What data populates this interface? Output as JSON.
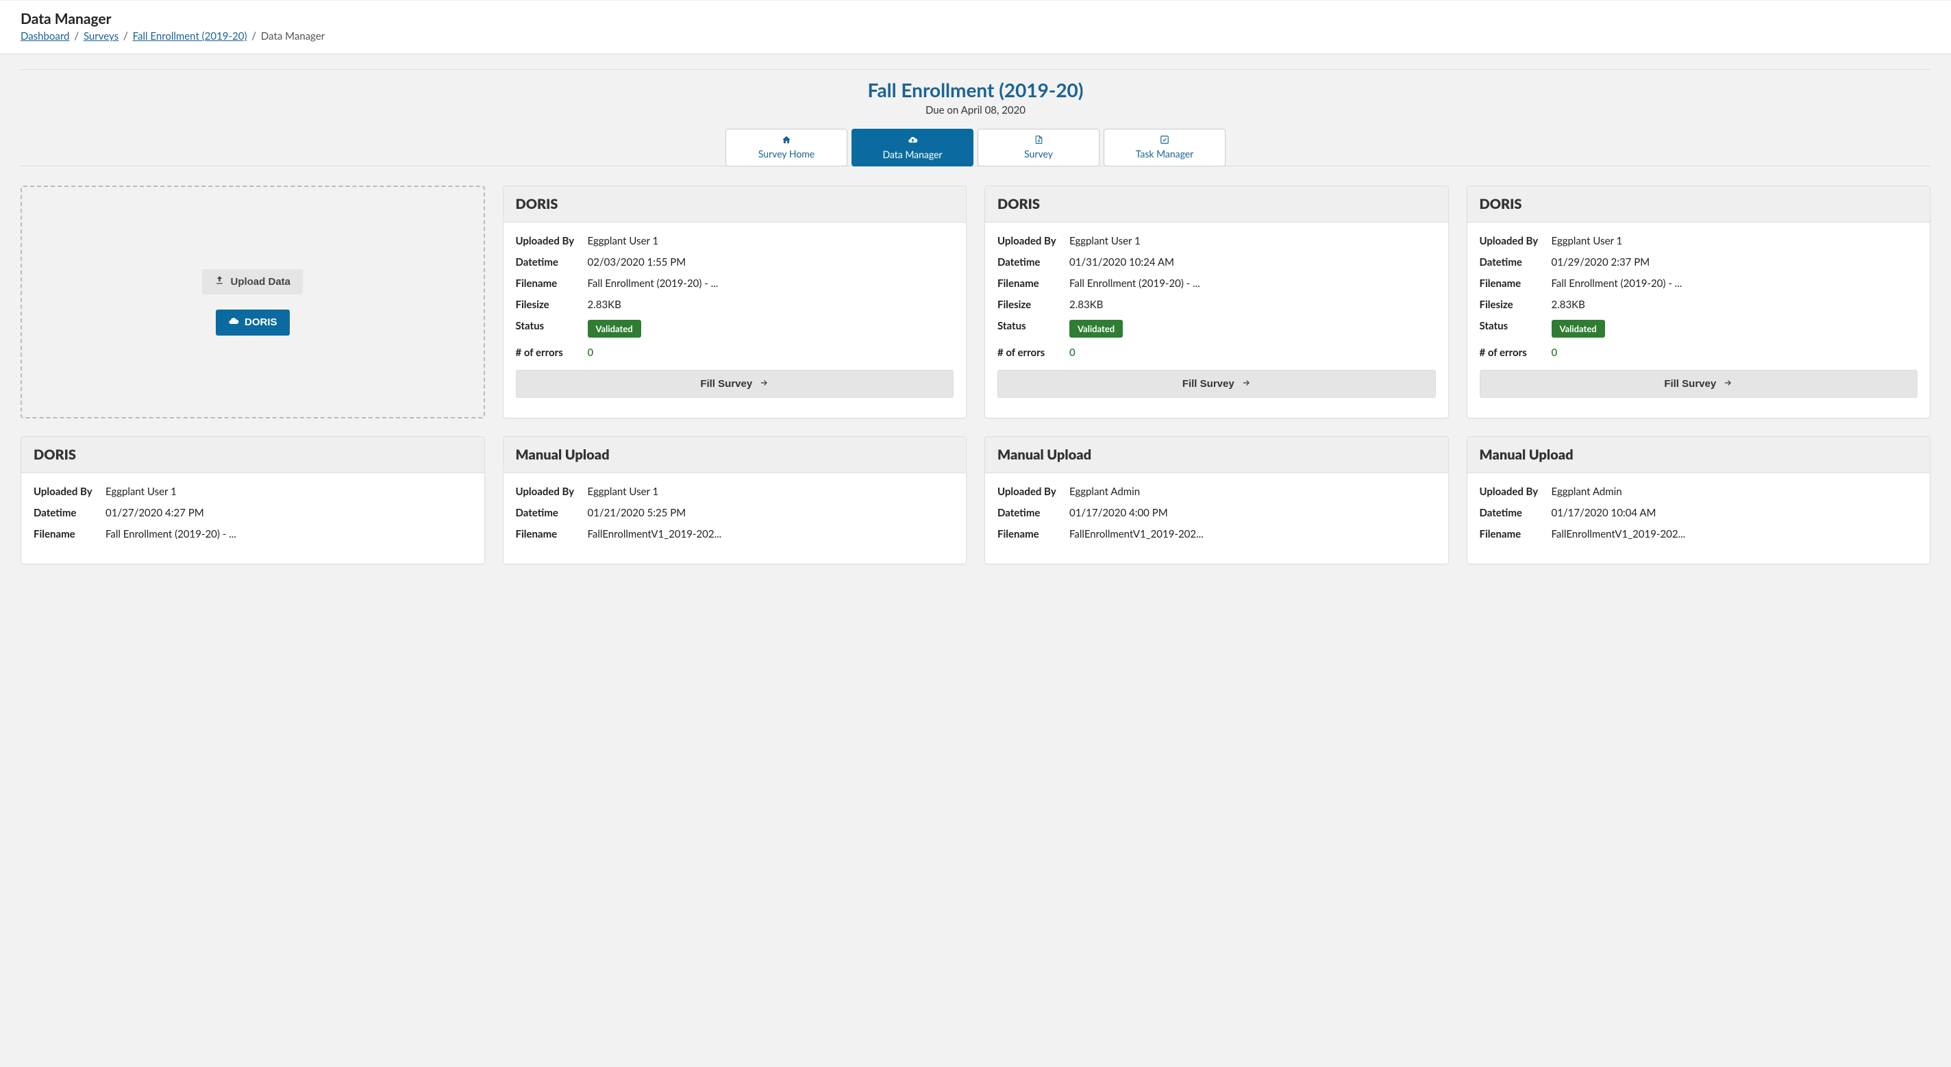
{
  "header": {
    "title": "Data Manager",
    "breadcrumb": {
      "items": [
        "Dashboard",
        "Surveys",
        "Fall Enrollment (2019-20)"
      ],
      "current": "Data Manager"
    }
  },
  "survey": {
    "title": "Fall Enrollment (2019-20)",
    "due": "Due on April 08, 2020"
  },
  "tabs": [
    {
      "label": "Survey Home",
      "icon": "home"
    },
    {
      "label": "Data Manager",
      "icon": "cloud-upload",
      "active": true
    },
    {
      "label": "Survey",
      "icon": "file"
    },
    {
      "label": "Task Manager",
      "icon": "check-square"
    }
  ],
  "uploadBox": {
    "uploadLabel": "Upload Data",
    "dorisLabel": "DORIS"
  },
  "labels": {
    "uploadedBy": "Uploaded By",
    "datetime": "Datetime",
    "filename": "Filename",
    "filesize": "Filesize",
    "status": "Status",
    "errors": "# of errors",
    "fillSurvey": "Fill Survey"
  },
  "cards": [
    {
      "title": "DORIS",
      "uploadedBy": "Eggplant User 1",
      "datetime": "02/03/2020 1:55 PM",
      "filename": "Fall Enrollment (2019-20) - ...",
      "filesize": "2.83KB",
      "status": "Validated",
      "errors": "0",
      "showFill": true
    },
    {
      "title": "DORIS",
      "uploadedBy": "Eggplant User 1",
      "datetime": "01/31/2020 10:24 AM",
      "filename": "Fall Enrollment (2019-20) - ...",
      "filesize": "2.83KB",
      "status": "Validated",
      "errors": "0",
      "showFill": true
    },
    {
      "title": "DORIS",
      "uploadedBy": "Eggplant User 1",
      "datetime": "01/29/2020 2:37 PM",
      "filename": "Fall Enrollment (2019-20) - ...",
      "filesize": "2.83KB",
      "status": "Validated",
      "errors": "0",
      "showFill": true
    },
    {
      "title": "DORIS",
      "uploadedBy": "Eggplant User 1",
      "datetime": "01/27/2020 4:27 PM",
      "filename": "Fall Enrollment (2019-20) - ..."
    },
    {
      "title": "Manual Upload",
      "uploadedBy": "Eggplant User 1",
      "datetime": "01/21/2020 5:25 PM",
      "filename": "FallEnrollmentV1_2019-202..."
    },
    {
      "title": "Manual Upload",
      "uploadedBy": "Eggplant Admin",
      "datetime": "01/17/2020 4:00 PM",
      "filename": "FallEnrollmentV1_2019-202..."
    },
    {
      "title": "Manual Upload",
      "uploadedBy": "Eggplant Admin",
      "datetime": "01/17/2020 10:04 AM",
      "filename": "FallEnrollmentV1_2019-202..."
    }
  ]
}
